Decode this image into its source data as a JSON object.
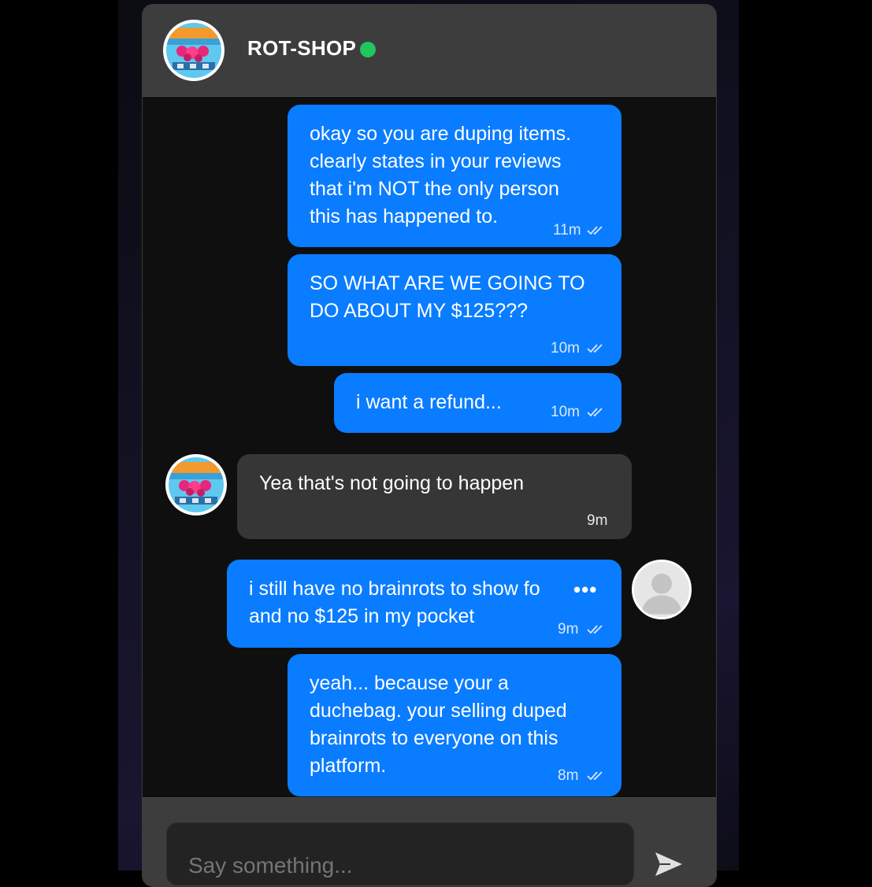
{
  "header": {
    "shop_name": "ROT-SHOP",
    "online_color": "#22c55e"
  },
  "messages": [
    {
      "sender": "me",
      "text": "okay so you are duping items.\nclearly states in your reviews\nthat i'm NOT the only person\nthis has happened to.",
      "time": "11m",
      "read": true
    },
    {
      "sender": "me",
      "text": "SO WHAT ARE WE GOING TO\nDO ABOUT MY $125???",
      "time": "10m",
      "read": true
    },
    {
      "sender": "me",
      "text": "i want a refund...",
      "time": "10m",
      "read": true
    },
    {
      "sender": "them",
      "text": "Yea that's not going to happen",
      "time": "9m"
    },
    {
      "sender": "me",
      "text": "i still have no brainrots to show fo\nand no $125 in my pocket",
      "time": "9m",
      "read": true,
      "more_icon": "more-options-icon"
    },
    {
      "sender": "me",
      "text": "yeah... because your a\nduchebag. your selling duped\nbrainrots to everyone on this\nplatform.",
      "time": "8m",
      "read": true
    }
  ],
  "composer": {
    "placeholder": "Say something...",
    "send_icon": "send-icon"
  },
  "colors": {
    "my_bubble": "#0a7cff",
    "their_bubble": "#363636",
    "header": "#3d3d3d"
  }
}
